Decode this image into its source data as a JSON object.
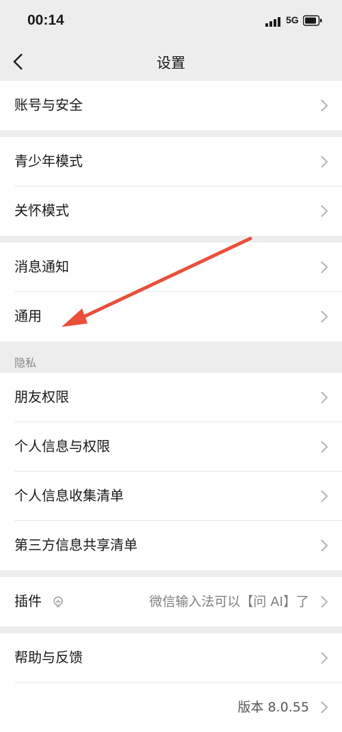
{
  "status": {
    "time": "00:14",
    "network": "5G"
  },
  "nav": {
    "title": "设置"
  },
  "rows": {
    "account_security": "账号与安全",
    "teen_mode": "青少年模式",
    "care_mode": "关怀模式",
    "notifications": "消息通知",
    "general": "通用",
    "privacy_header": "隐私",
    "friend_permissions": "朋友权限",
    "personal_info_permissions": "个人信息与权限",
    "personal_info_collection": "个人信息收集清单",
    "third_party_sharing": "第三方信息共享清单",
    "plugins": "插件",
    "plugins_value": "微信输入法可以【问 AI】了",
    "help_feedback": "帮助与反馈",
    "version": "版本 8.0.55"
  },
  "icons": {
    "back": "chevron-left-icon",
    "chevron": "chevron-right-icon",
    "plugin": "lightbulb-icon"
  },
  "colors": {
    "annotation_arrow": "#e8503a",
    "background": "#ededed"
  }
}
